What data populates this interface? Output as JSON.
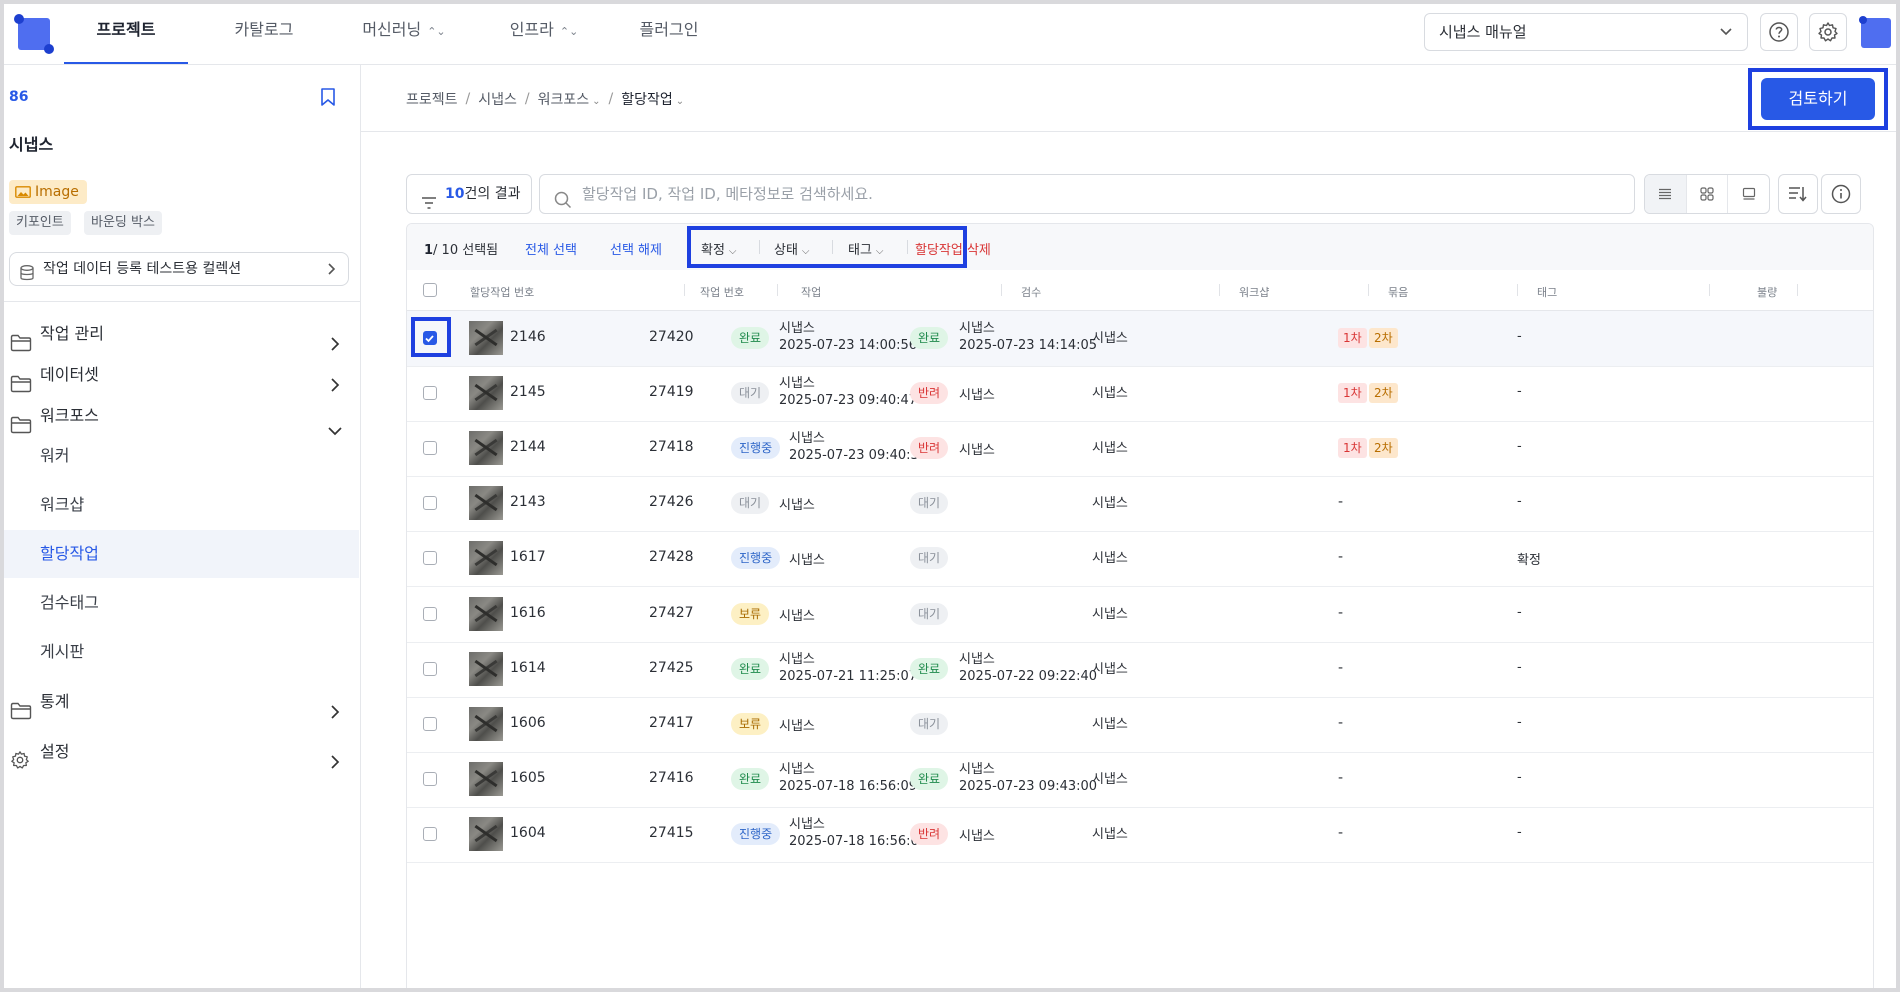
{
  "nav": {
    "tabs": [
      {
        "label": "프로젝트"
      },
      {
        "label": "카탈로그"
      },
      {
        "label": "머신러닝"
      },
      {
        "label": "인프라"
      },
      {
        "label": "플러그인"
      }
    ],
    "manual_select": "시냅스 매뉴얼"
  },
  "sidebar": {
    "project_id": "86",
    "project_name": "시냅스",
    "data_type": "Image",
    "annotation_tags": [
      "키포인트",
      "바운딩 박스"
    ],
    "collection": "작업 데이터 등록 테스트용 컬렉션",
    "menu": {
      "task_mgmt": "작업 관리",
      "dataset": "데이터셋",
      "workforce": "워크포스",
      "worker": "워커",
      "workshop": "워크샵",
      "assignment": "할당작업",
      "review_tag": "검수태그",
      "board": "게시판",
      "stats": "통계",
      "settings": "설정"
    }
  },
  "main": {
    "breadcrumb": [
      "프로젝트",
      "시냅스",
      "워크포스",
      "할당작업"
    ],
    "review_button": "검토하기",
    "result_count": "10",
    "result_suffix": "건의 결과",
    "search_placeholder": "할당작업 ID, 작업 ID, 메타정보로 검색하세요.",
    "selection": {
      "selected": "1",
      "total": "/ 10 선택됨",
      "select_all": "전체 선택",
      "deselect": "선택 해제",
      "confirm": "확정",
      "status": "상태",
      "tag": "태그",
      "delete": "할당작업 삭제"
    },
    "columns": [
      "할당작업 번호",
      "작업 번호",
      "작업",
      "검수",
      "워크샵",
      "묶음",
      "태그",
      "불량"
    ],
    "rows": [
      {
        "id": "2146",
        "task": "27420",
        "work_status": "완료",
        "work_color": "green",
        "worker": "시냅스",
        "work_time": "2025-07-23 14:00:56",
        "review_status": "완료",
        "review_color": "green",
        "reviewer": "시냅스",
        "review_time": "2025-07-23 14:14:05",
        "workshop": "시냅스",
        "tags": [
          "1차",
          "2차"
        ],
        "defect": "-",
        "checked": true
      },
      {
        "id": "2145",
        "task": "27419",
        "work_status": "대기",
        "work_color": "gray",
        "worker": "시냅스",
        "work_time": "2025-07-23 09:40:47",
        "review_status": "반려",
        "review_color": "red",
        "reviewer": "시냅스",
        "review_time": "",
        "workshop": "시냅스",
        "tags": [
          "1차",
          "2차"
        ],
        "defect": "-",
        "checked": false
      },
      {
        "id": "2144",
        "task": "27418",
        "work_status": "진행중",
        "work_color": "blue",
        "worker": "시냅스",
        "work_time": "2025-07-23 09:40:3",
        "review_status": "반려",
        "review_color": "red",
        "reviewer": "시냅스",
        "review_time": "",
        "workshop": "시냅스",
        "tags": [
          "1차",
          "2차"
        ],
        "defect": "-",
        "checked": false
      },
      {
        "id": "2143",
        "task": "27426",
        "work_status": "대기",
        "work_color": "gray",
        "worker": "시냅스",
        "work_time": "",
        "review_status": "대기",
        "review_color": "gray",
        "reviewer": "",
        "review_time": "",
        "workshop": "시냅스",
        "tags": [],
        "tag_text": "-",
        "defect": "-",
        "checked": false
      },
      {
        "id": "1617",
        "task": "27428",
        "work_status": "진행중",
        "work_color": "blue",
        "worker": "시냅스",
        "work_time": "",
        "review_status": "대기",
        "review_color": "gray",
        "reviewer": "",
        "review_time": "",
        "workshop": "시냅스",
        "tags": [],
        "tag_text": "-",
        "defect": "확정",
        "checked": false
      },
      {
        "id": "1616",
        "task": "27427",
        "work_status": "보류",
        "work_color": "yellow",
        "worker": "시냅스",
        "work_time": "",
        "review_status": "대기",
        "review_color": "gray",
        "reviewer": "",
        "review_time": "",
        "workshop": "시냅스",
        "tags": [],
        "tag_text": "-",
        "defect": "-",
        "checked": false
      },
      {
        "id": "1614",
        "task": "27425",
        "work_status": "완료",
        "work_color": "green",
        "worker": "시냅스",
        "work_time": "2025-07-21 11:25:07",
        "review_status": "완료",
        "review_color": "green",
        "reviewer": "시냅스",
        "review_time": "2025-07-22 09:22:40",
        "workshop": "시냅스",
        "tags": [],
        "tag_text": "-",
        "defect": "-",
        "checked": false
      },
      {
        "id": "1606",
        "task": "27417",
        "work_status": "보류",
        "work_color": "yellow",
        "worker": "시냅스",
        "work_time": "",
        "review_status": "대기",
        "review_color": "gray",
        "reviewer": "",
        "review_time": "",
        "workshop": "시냅스",
        "tags": [],
        "tag_text": "-",
        "defect": "-",
        "checked": false
      },
      {
        "id": "1605",
        "task": "27416",
        "work_status": "완료",
        "work_color": "green",
        "worker": "시냅스",
        "work_time": "2025-07-18 16:56:09",
        "review_status": "완료",
        "review_color": "green",
        "reviewer": "시냅스",
        "review_time": "2025-07-23 09:43:00",
        "workshop": "시냅스",
        "tags": [],
        "tag_text": "-",
        "defect": "-",
        "checked": false
      },
      {
        "id": "1604",
        "task": "27415",
        "work_status": "진행중",
        "work_color": "blue",
        "worker": "시냅스",
        "work_time": "2025-07-18 16:56:0",
        "review_status": "반려",
        "review_color": "red",
        "reviewer": "시냅스",
        "review_time": "",
        "workshop": "시냅스",
        "tags": [],
        "tag_text": "-",
        "defect": "-",
        "checked": false
      }
    ]
  },
  "colors": {
    "accent": "#2859e6",
    "highlight": "#1e40e0"
  }
}
